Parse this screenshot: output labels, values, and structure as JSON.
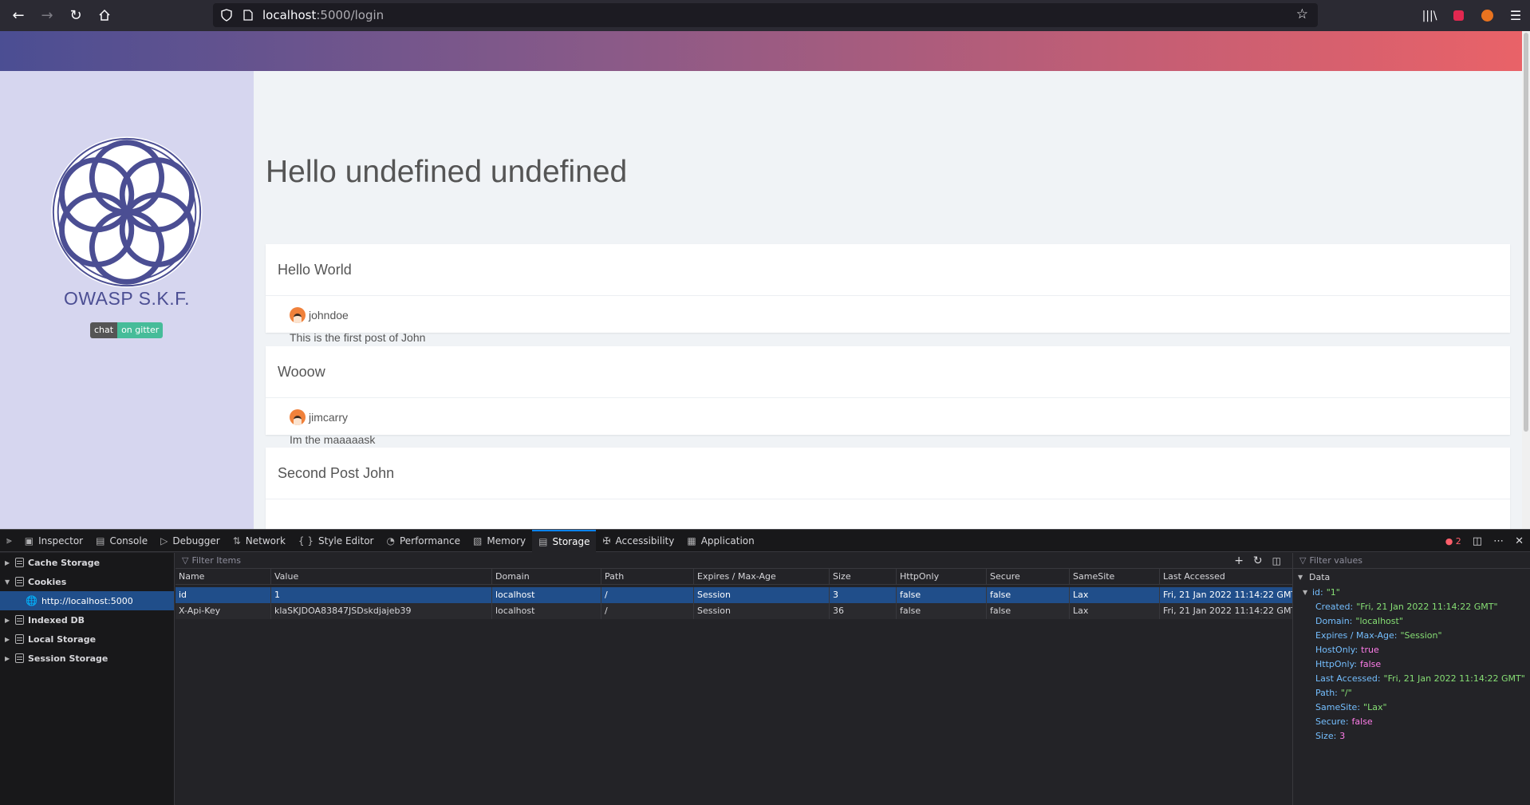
{
  "browser": {
    "url_host": "localhost",
    "url_path": ":5000/login"
  },
  "sidebar": {
    "brand": "OWASP S.K.F.",
    "badge_left": "chat",
    "badge_right": "on gitter"
  },
  "main": {
    "heading": "Hello undefined undefined",
    "posts": [
      {
        "title": "Hello World",
        "author": "johndoe",
        "body": "This is the first post of John"
      },
      {
        "title": "Wooow",
        "author": "jimcarry",
        "body": "Im the maaaaask"
      },
      {
        "title": "Second Post John",
        "author": "",
        "body": ""
      }
    ]
  },
  "devtools": {
    "tabs": [
      "Inspector",
      "Console",
      "Debugger",
      "Network",
      "Style Editor",
      "Performance",
      "Memory",
      "Storage",
      "Accessibility",
      "Application"
    ],
    "active_tab": "Storage",
    "error_count": "2",
    "tree": {
      "cache_storage": "Cache Storage",
      "cookies": "Cookies",
      "cookies_host": "http://localhost:5000",
      "indexed_db": "Indexed DB",
      "local_storage": "Local Storage",
      "session_storage": "Session Storage"
    },
    "filter_placeholder": "Filter Items",
    "columns": [
      "Name",
      "Value",
      "Domain",
      "Path",
      "Expires / Max-Age",
      "Size",
      "HttpOnly",
      "Secure",
      "SameSite",
      "Last Accessed"
    ],
    "rows": [
      [
        "id",
        "1",
        "localhost",
        "/",
        "Session",
        "3",
        "false",
        "false",
        "Lax",
        "Fri, 21 Jan 2022 11:14:22 GMT"
      ],
      [
        "X-Api-Key",
        "klaSKJDOA83847JSDskdjajeb39",
        "localhost",
        "/",
        "Session",
        "36",
        "false",
        "false",
        "Lax",
        "Fri, 21 Jan 2022 11:14:22 GMT"
      ]
    ],
    "side": {
      "filter_placeholder": "Filter values",
      "section": "Data",
      "top_key": "id:",
      "top_val": "\"1\"",
      "items": [
        {
          "k": "Created:",
          "v": "\"Fri, 21 Jan 2022 11:14:22 GMT\"",
          "t": "s"
        },
        {
          "k": "Domain:",
          "v": "\"localhost\"",
          "t": "s"
        },
        {
          "k": "Expires / Max-Age:",
          "v": "\"Session\"",
          "t": "s"
        },
        {
          "k": "HostOnly:",
          "v": "true",
          "t": "b"
        },
        {
          "k": "HttpOnly:",
          "v": "false",
          "t": "b"
        },
        {
          "k": "Last Accessed:",
          "v": "\"Fri, 21 Jan 2022 11:14:22 GMT\"",
          "t": "s"
        },
        {
          "k": "Path:",
          "v": "\"/\"",
          "t": "s"
        },
        {
          "k": "SameSite:",
          "v": "\"Lax\"",
          "t": "s"
        },
        {
          "k": "Secure:",
          "v": "false",
          "t": "b"
        },
        {
          "k": "Size:",
          "v": "3",
          "t": "n"
        }
      ]
    }
  }
}
